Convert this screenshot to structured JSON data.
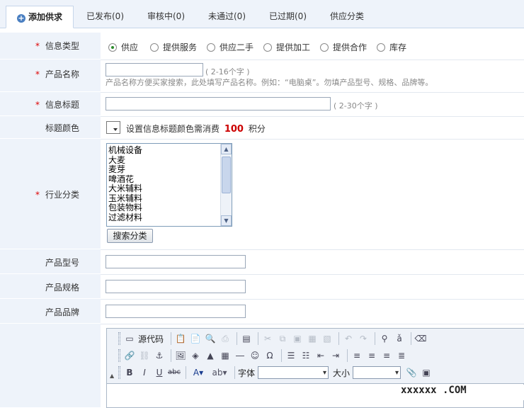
{
  "tabs": [
    {
      "label": "添加供求",
      "active": true
    },
    {
      "label": "已发布(0)"
    },
    {
      "label": "审核中(0)"
    },
    {
      "label": "未通过(0)"
    },
    {
      "label": "已过期(0)"
    },
    {
      "label": "供应分类"
    }
  ],
  "form": {
    "info_type": {
      "label": "信息类型",
      "options": [
        "供应",
        "提供服务",
        "供应二手",
        "提供加工",
        "提供合作",
        "库存"
      ],
      "selected": "供应"
    },
    "product_name": {
      "label": "产品名称",
      "value": "",
      "hint": "( 2-16个字 )",
      "help": "产品名称方便买家搜索，此处填写产品名称。例如：“电脑桌”。勿填产品型号、规格、品牌等。"
    },
    "title": {
      "label": "信息标题",
      "value": "",
      "hint": "( 2-30个字 )"
    },
    "title_color": {
      "label": "标题颜色",
      "text": "设置信息标题颜色需消费",
      "cost": "100",
      "unit": "积分"
    },
    "industry": {
      "label": "行业分类",
      "items": [
        "机械设备",
        "大麦",
        "麦芽",
        "啤酒花",
        "大米辅料",
        "玉米辅料",
        "包装物料",
        "过滤材料"
      ],
      "button": "搜索分类"
    },
    "model": {
      "label": "产品型号",
      "value": ""
    },
    "spec": {
      "label": "产品规格",
      "value": ""
    },
    "brand": {
      "label": "产品品牌",
      "value": ""
    }
  },
  "editor": {
    "source_label": "源代码",
    "font_label": "字体",
    "size_label": "大小"
  },
  "watermark": "xxxxxx  .COM"
}
